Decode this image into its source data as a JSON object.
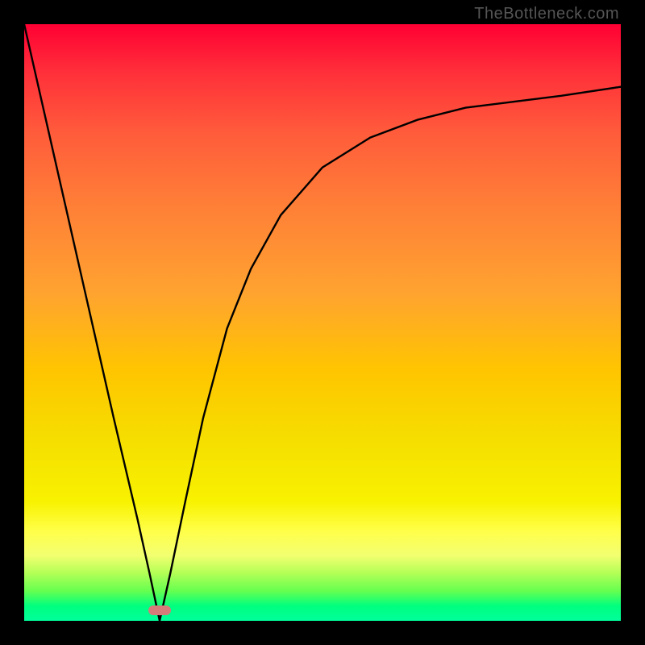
{
  "attribution": {
    "text": "TheBottleneck.com",
    "color": "#555555"
  },
  "frame": {
    "border_color": "#000000",
    "border_px": 30,
    "inner_size_px": 740
  },
  "gradient": {
    "stops": [
      {
        "pos": 0.0,
        "color": "#ff0033"
      },
      {
        "pos": 0.08,
        "color": "#ff2f3a"
      },
      {
        "pos": 0.18,
        "color": "#ff5b3b"
      },
      {
        "pos": 0.3,
        "color": "#ff7e37"
      },
      {
        "pos": 0.45,
        "color": "#ffa330"
      },
      {
        "pos": 0.58,
        "color": "#ffc500"
      },
      {
        "pos": 0.7,
        "color": "#f5df00"
      },
      {
        "pos": 0.8,
        "color": "#f8f200"
      },
      {
        "pos": 0.85,
        "color": "#ffff4a"
      },
      {
        "pos": 0.89,
        "color": "#f3ff70"
      },
      {
        "pos": 0.92,
        "color": "#b3ff57"
      },
      {
        "pos": 0.95,
        "color": "#66ff50"
      },
      {
        "pos": 0.975,
        "color": "#00ff7e"
      },
      {
        "pos": 1.0,
        "color": "#00ff9c"
      }
    ]
  },
  "marker": {
    "x_frac": 0.227,
    "y_frac": 0.983,
    "color": "#d67a7a"
  },
  "chart_data": {
    "type": "line",
    "title": "",
    "xlabel": "",
    "ylabel": "",
    "xlim": [
      0,
      1
    ],
    "ylim": [
      0,
      1
    ],
    "note": "No axes, ticks, or textual labels are rendered in the image; x/y are normalized to the plot area. Higher y = lower on screen (row 0 at top).",
    "series": [
      {
        "name": "curve",
        "x": [
          0.0,
          0.05,
          0.1,
          0.15,
          0.19,
          0.21,
          0.227,
          0.245,
          0.27,
          0.3,
          0.34,
          0.38,
          0.43,
          0.5,
          0.58,
          0.66,
          0.74,
          0.82,
          0.9,
          1.0
        ],
        "y": [
          1.0,
          0.78,
          0.56,
          0.34,
          0.17,
          0.08,
          0.0,
          0.08,
          0.2,
          0.34,
          0.49,
          0.59,
          0.68,
          0.76,
          0.81,
          0.84,
          0.86,
          0.87,
          0.88,
          0.895
        ]
      }
    ],
    "marker_point": {
      "x": 0.227,
      "y": 0.0
    }
  }
}
